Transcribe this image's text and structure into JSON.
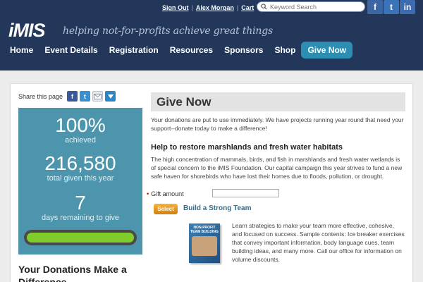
{
  "header": {
    "links": {
      "sign_out": "Sign Out",
      "user": "Alex Morgan",
      "cart": "Cart"
    },
    "search": {
      "placeholder": "Keyword Search"
    },
    "social": {
      "facebook": "f",
      "twitter": "t",
      "linkedin": "in"
    },
    "logo": {
      "text": "iMIS"
    },
    "tagline": "helping not-for-profits achieve great things"
  },
  "nav": {
    "items": [
      "Home",
      "Event Details",
      "Registration",
      "Resources",
      "Sponsors",
      "Shop",
      "Give Now"
    ]
  },
  "sidebar": {
    "share_label": "Share this page",
    "stats": {
      "achieved_value": "100%",
      "achieved_label": "achieved",
      "total_value": "216,580",
      "total_label": "total given this year",
      "days_value": "7",
      "days_label": "days remaining to give",
      "progress_fraction": 1.0
    },
    "donations_title": "Your Donations Make a Difference"
  },
  "main": {
    "title": "Give Now",
    "intro": "Your donations are put to use immediately. We have projects running year round that need your support--donate today to make a difference!",
    "section_title": "Help to restore marshlands and fresh water habitats",
    "section_text": "The high concentration of mammals, birds, and fish in marshlands and fresh water wetlands is of special concern to the iMIS Foundation. Our capital campaign this year strives to fund a new safe haven for shorebirds who have lost their homes due to floods, pollution, or drought.",
    "gift_label": "Gift amount",
    "gift_value": "",
    "select_label": "Select",
    "product_title": "Build a Strong Team",
    "book_cover": "NON-PROFIT TEAM BUILDING",
    "product_desc": "Learn strategies to make your team more effective, cohesive, and focused on success. Sample contents: Ice breaker exercises that convey important information, body language cues, team building ideas, and many more. Call our office for information on volume discounts."
  },
  "colors": {
    "header_bg": "#23375a",
    "nav_active": "#2b8fb3",
    "stats_bg": "#4c95ad",
    "progress_fill": "#7fcc2b",
    "select_button": "#e89a1f",
    "link_blue": "#2f6e92"
  },
  "icons": [
    "cart-icon",
    "search-icon",
    "facebook-icon",
    "twitter-icon",
    "linkedin-icon",
    "email-icon",
    "share-more-icon"
  ]
}
